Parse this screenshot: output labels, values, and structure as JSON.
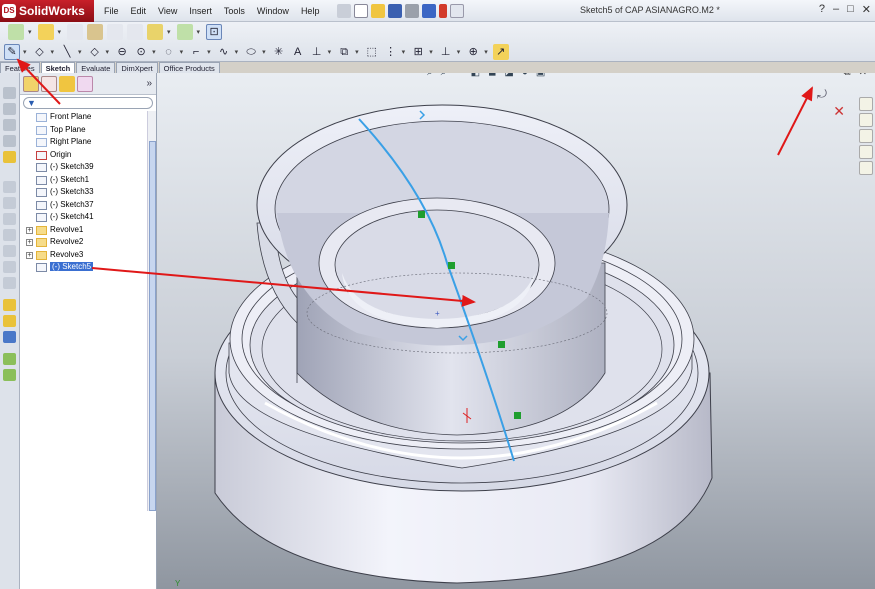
{
  "app": {
    "logo_text": "SolidWorks",
    "logo_badge": "DS",
    "document_title": "Sketch5 of CAP ASIANAGRO.M2 *"
  },
  "menu": [
    "File",
    "Edit",
    "View",
    "Insert",
    "Tools",
    "Window",
    "Help"
  ],
  "window_buttons": {
    "help": "?",
    "minimize": "–",
    "maximize": "□",
    "close": "✕"
  },
  "command_tabs": [
    "Features",
    "Sketch",
    "Evaluate",
    "DimXpert",
    "Office Products"
  ],
  "active_tab": "Sketch",
  "feature_tree": {
    "more": "»",
    "filter_icon": "funnel-icon",
    "items": [
      {
        "label": "Front Plane",
        "icon": "plane-icon",
        "expandable": false
      },
      {
        "label": "Top Plane",
        "icon": "plane-icon",
        "expandable": false
      },
      {
        "label": "Right Plane",
        "icon": "plane-icon",
        "expandable": false
      },
      {
        "label": "Origin",
        "icon": "origin-icon",
        "expandable": false
      },
      {
        "label": "(-) Sketch39",
        "icon": "sketch-icon",
        "expandable": false
      },
      {
        "label": "(-) Sketch1",
        "icon": "sketch-icon",
        "expandable": false
      },
      {
        "label": "(-) Sketch33",
        "icon": "sketch-icon",
        "expandable": false
      },
      {
        "label": "(-) Sketch37",
        "icon": "sketch-icon",
        "expandable": false
      },
      {
        "label": "(-) Sketch41",
        "icon": "sketch-icon",
        "expandable": false
      },
      {
        "label": "Revolve1",
        "icon": "revolve-icon",
        "expandable": true
      },
      {
        "label": "Revolve2",
        "icon": "revolve-icon",
        "expandable": true
      },
      {
        "label": "Revolve3",
        "icon": "revolve-icon",
        "expandable": true
      },
      {
        "label": "(-) Sketch5",
        "icon": "sketch-icon",
        "expandable": false,
        "selected": true
      }
    ]
  },
  "expand_glyph": "+",
  "viewport": {
    "heads_up_icons": [
      "zoom-to-fit-icon",
      "zoom-area-icon",
      "previous-view-icon",
      "section-view-icon",
      "view-orientation-icon",
      "display-style-icon",
      "appearance-icon",
      "scene-icon"
    ],
    "window_controls": [
      "–",
      "⧉",
      "✕"
    ],
    "confirm_glyph": "✕",
    "axis_label": "Y"
  },
  "colors": {
    "selection": "#3a6fd1",
    "sketch_curve": "#3aa0e6",
    "annotation_arrow": "#e01818",
    "relation_marker": "#1f9e2e"
  }
}
